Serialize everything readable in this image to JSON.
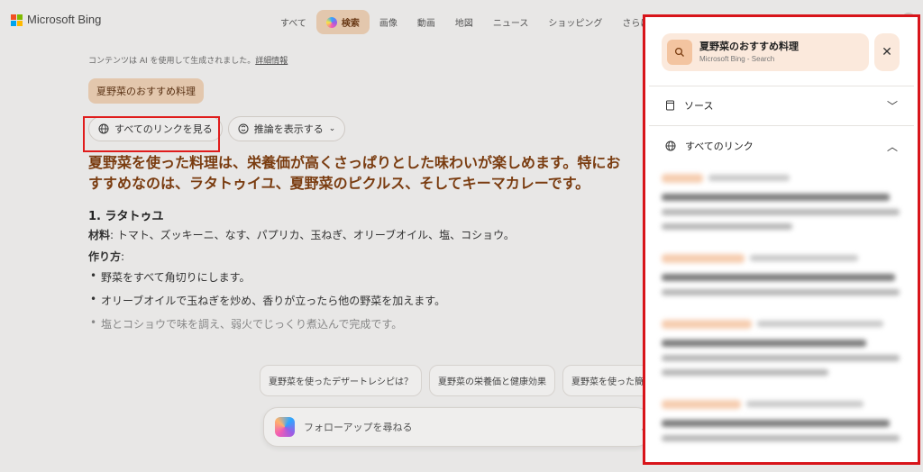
{
  "brand": {
    "name": "Microsoft Bing"
  },
  "nav": {
    "tabs": [
      "すべて",
      "検索",
      "画像",
      "動画",
      "地図",
      "ニュース",
      "ショッピング",
      "さらに表示"
    ],
    "active_index": 1
  },
  "main": {
    "ai_note": "コンテンツは AI を使用して生成されました。",
    "ai_note_link": "詳細情報",
    "query_chip": "夏野菜のおすすめ料理",
    "buttons": {
      "all_links": "すべてのリンクを見る",
      "show_reasoning": "推論を表示する"
    },
    "answer": "夏野菜を使った料理は、栄養価が高くさっぱりとした味わいが楽しめます。特におすすめなのは、ラタトゥイユ、夏野菜のピクルス、そしてキーマカレーです。",
    "section1": {
      "title": "1. ラタトゥユ",
      "materials_label": "材料",
      "materials": ": トマト、ズッキーニ、なす、パプリカ、玉ねぎ、オリーブオイル、塩、コショウ。",
      "howto_label": "作り方",
      "howto_colon": ":",
      "steps": [
        "野菜をすべて角切りにします。",
        "オリーブオイルで玉ねぎを炒め、香りが立ったら他の野菜を加えます。",
        "塩とコショウで味を調え、弱火でじっくり煮込んで完成です。"
      ]
    }
  },
  "suggestions": [
    "夏野菜を使ったデザートレシピは？",
    "夏野菜の栄養価と健康効果",
    "夏野菜を使った簡単サラ"
  ],
  "followup": {
    "placeholder": "フォローアップを尋ねる"
  },
  "panel": {
    "search_title": "夏野菜のおすすめ料理",
    "search_sub": "Microsoft Bing - Search",
    "sources_label": "ソース",
    "all_links_label": "すべてのリンク"
  },
  "colors": {
    "accent": "#e3c7ad",
    "answer_text": "#7a3c10",
    "highlight": "#e01c1c"
  }
}
